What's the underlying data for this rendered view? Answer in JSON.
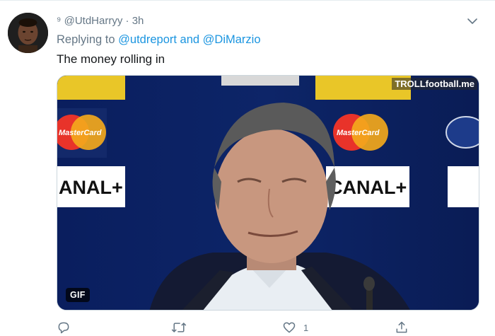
{
  "tweet": {
    "reply_rank": "⁹",
    "handle": "@UtdHarryy",
    "separator": "·",
    "time": "3h",
    "replying_to_prefix": "Replying to",
    "mention_1": "@utdreport",
    "and_word": "and",
    "mention_2": "@DiMarzio",
    "text": "The money rolling in"
  },
  "media": {
    "badge": "GIF",
    "watermark": "TROLLfootball.me",
    "banner_sponsor": "MasterCard",
    "banner_canal": "ANAL+",
    "banner_canal_2": "CANAL+"
  },
  "actions": {
    "reply_count": "",
    "retweet_count": "",
    "like_count": "1",
    "share_count": ""
  },
  "colors": {
    "link": "#1b95e0",
    "muted": "#657786",
    "text": "#14171a"
  }
}
